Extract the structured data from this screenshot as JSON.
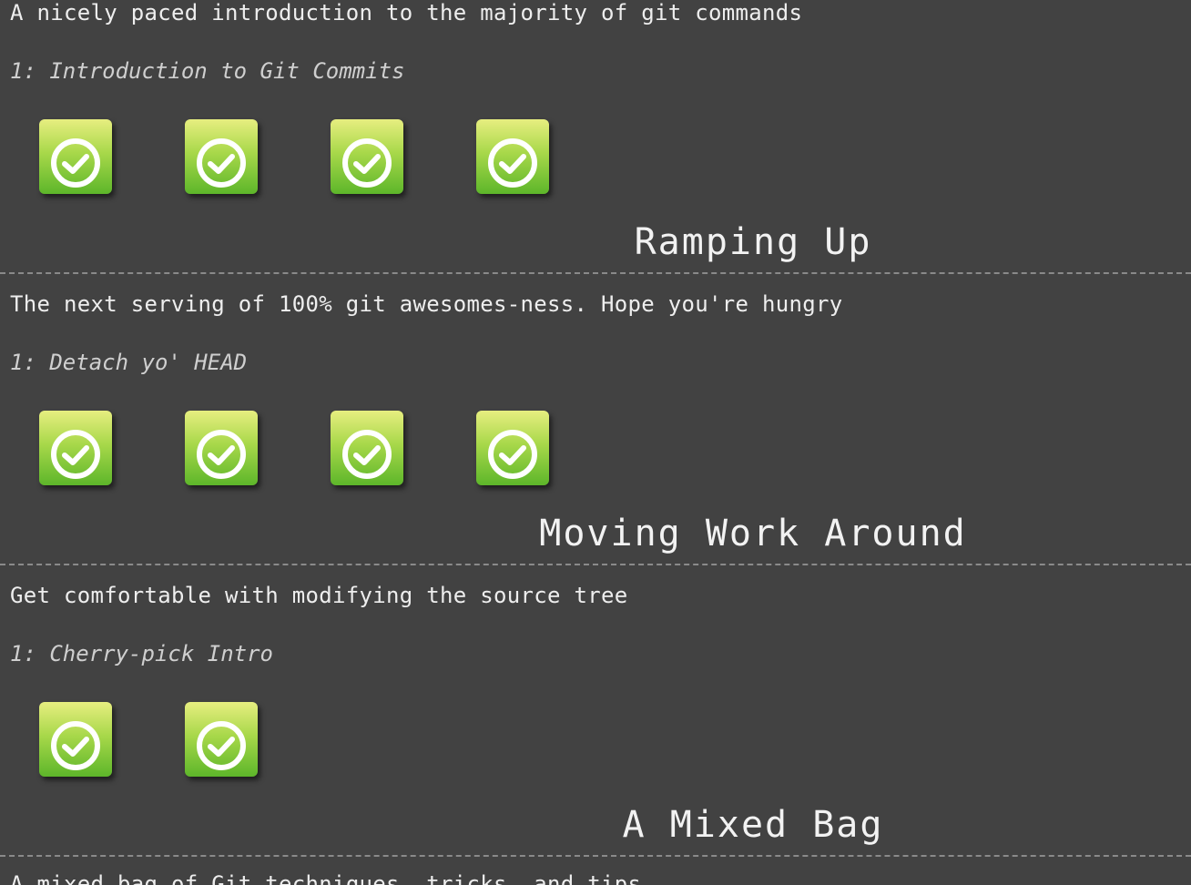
{
  "sequences": [
    {
      "description": "A nicely paced introduction to the majority of git commands",
      "level_label": "1: Introduction to Git Commits",
      "levels": [
        {
          "status": "solved",
          "icon": "checkmark-circle-icon"
        },
        {
          "status": "solved",
          "icon": "checkmark-circle-icon"
        },
        {
          "status": "solved",
          "icon": "checkmark-circle-icon"
        },
        {
          "status": "solved",
          "icon": "checkmark-circle-icon"
        }
      ]
    },
    {
      "title": "Ramping Up",
      "description": "The next serving of 100% git awesomes-ness. Hope you're hungry",
      "level_label": "1: Detach yo' HEAD",
      "levels": [
        {
          "status": "solved",
          "icon": "checkmark-circle-icon"
        },
        {
          "status": "solved",
          "icon": "checkmark-circle-icon"
        },
        {
          "status": "solved",
          "icon": "checkmark-circle-icon"
        },
        {
          "status": "solved",
          "icon": "checkmark-circle-icon"
        }
      ]
    },
    {
      "title": "Moving Work Around",
      "description": "Get comfortable with modifying the source tree",
      "level_label": "1: Cherry-pick Intro",
      "levels": [
        {
          "status": "solved",
          "icon": "checkmark-circle-icon"
        },
        {
          "status": "solved",
          "icon": "checkmark-circle-icon"
        }
      ]
    },
    {
      "title": "A Mixed Bag",
      "description": "A mixed bag of Git techniques, tricks, and tips"
    }
  ],
  "colors": {
    "background": "#424242",
    "text": "#eeeeee",
    "level_solved_top": "#e7ee80",
    "level_solved_bottom": "#5db62a",
    "divider": "#8a8a8a"
  }
}
